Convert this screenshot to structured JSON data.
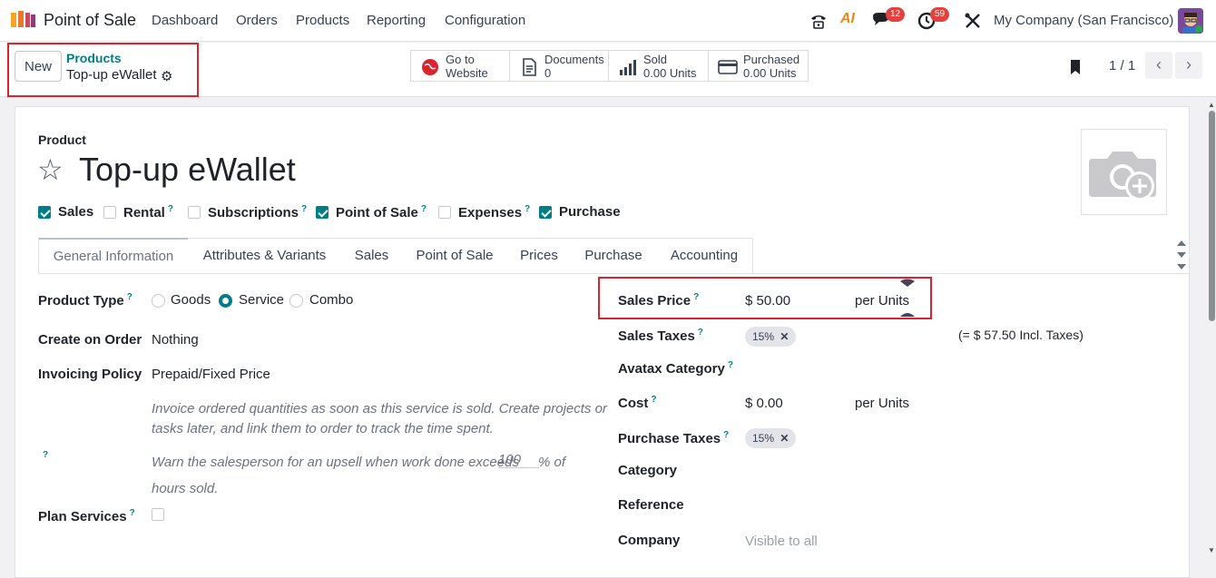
{
  "nav": {
    "app_name": "Point of Sale",
    "menu": [
      "Dashboard",
      "Orders",
      "Products",
      "Reporting",
      "Configuration"
    ],
    "chat_badge": "12",
    "activity_badge": "59",
    "ai_label": "AI",
    "company": "My Company (San Francisco)"
  },
  "control": {
    "new_label": "New",
    "breadcrumb_parent": "Products",
    "breadcrumb_current": "Top-up eWallet",
    "smart_buttons": [
      {
        "line1": "Go to",
        "line2": "Website",
        "icon": "globe-icon"
      },
      {
        "line1": "Documents",
        "line2": "0",
        "icon": "document-icon"
      },
      {
        "line1": "Sold",
        "line2": "0.00 Units",
        "icon": "bar-chart-icon"
      },
      {
        "line1": "Purchased",
        "line2": "0.00 Units",
        "icon": "credit-card-icon"
      }
    ],
    "pager": "1 / 1"
  },
  "product": {
    "section_label": "Product",
    "name": "Top-up eWallet",
    "flags": [
      {
        "label": "Sales",
        "checked": true,
        "help": false
      },
      {
        "label": "Rental",
        "checked": false,
        "help": true
      },
      {
        "label": "Subscriptions",
        "checked": false,
        "help": true
      },
      {
        "label": "Point of Sale",
        "checked": true,
        "help": true
      },
      {
        "label": "Expenses",
        "checked": false,
        "help": true
      },
      {
        "label": "Purchase",
        "checked": true,
        "help": false
      }
    ]
  },
  "tabs": [
    "General Information",
    "Attributes & Variants",
    "Sales",
    "Point of Sale",
    "Prices",
    "Purchase",
    "Accounting"
  ],
  "left": {
    "product_type_label": "Product Type",
    "type_options": [
      "Goods",
      "Service",
      "Combo"
    ],
    "type_selected": "Service",
    "create_on_order_label": "Create on Order",
    "create_on_order_value": "Nothing",
    "invoicing_policy_label": "Invoicing Policy",
    "invoicing_policy_value": "Prepaid/Fixed Price",
    "invoicing_hint_1": "Invoice ordered quantities as soon as this service is sold. Create projects or",
    "invoicing_hint_2": "tasks later, and link them to order to track the time spent.",
    "upsell_hint_1": "Warn the salesperson for an upsell when work done exceeds",
    "upsell_value": "100",
    "upsell_hint_2": "% of",
    "upsell_hint_3": "hours sold.",
    "plan_services_label": "Plan Services"
  },
  "right": {
    "sales_price_label": "Sales Price",
    "sales_price_value": "$ 50.00",
    "sales_price_unit": "per Units",
    "sales_taxes_label": "Sales Taxes",
    "sales_tax_tag": "15%",
    "incl_taxes": "(= $ 57.50 Incl. Taxes)",
    "avatax_label": "Avatax Category",
    "cost_label": "Cost",
    "cost_value": "$ 0.00",
    "cost_unit": "per Units",
    "purchase_taxes_label": "Purchase Taxes",
    "purchase_tax_tag": "15%",
    "category_label": "Category",
    "reference_label": "Reference",
    "company_label": "Company",
    "company_value": "Visible to all"
  },
  "colors": {
    "accent": "#017e84",
    "highlight": "#d9232e",
    "badge": "#e3413e"
  }
}
